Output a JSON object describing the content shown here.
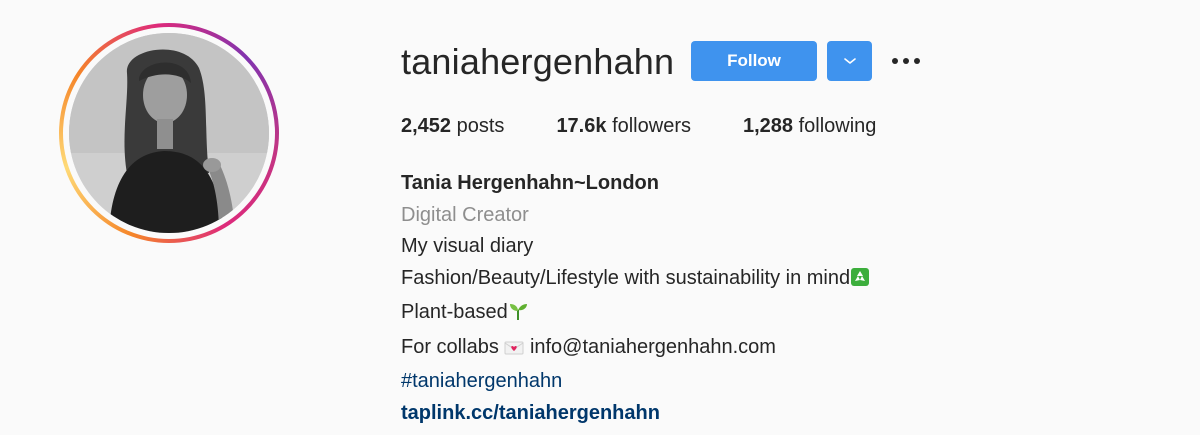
{
  "profile": {
    "username": "taniahergenhahn",
    "follow_label": "Follow",
    "dropdown_icon": "chevron-down-icon",
    "more_icon": "more-options-icon",
    "accent_color": "#3f93ee",
    "stats": {
      "posts_count": "2,452",
      "posts_label": "posts",
      "followers_count": "17.6k",
      "followers_label": "followers",
      "following_count": "1,288",
      "following_label": "following"
    },
    "bio": {
      "full_name": "Tania Hergenhahn~London",
      "category": "Digital Creator",
      "line1": "My visual diary",
      "line2": "Fashion/Beauty/Lifestyle with sustainability in mind",
      "line2_emoji": "recycle-icon",
      "line3": "Plant-based",
      "line3_emoji": "seedling-icon",
      "line4_prefix": "For collabs",
      "line4_emoji": "love-letter-icon",
      "line4_email": "info@taniahergenhahn.com",
      "hashtag": "#taniahergenhahn",
      "link": "taplink.cc/taniahergenhahn"
    }
  }
}
